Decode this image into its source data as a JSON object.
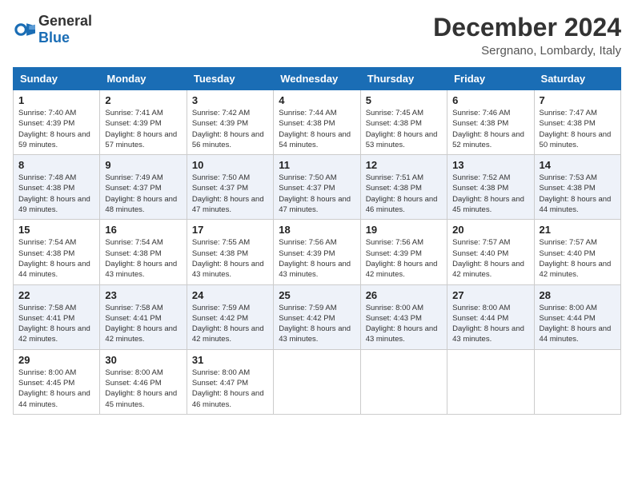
{
  "header": {
    "logo_general": "General",
    "logo_blue": "Blue",
    "month_year": "December 2024",
    "location": "Sergnano, Lombardy, Italy"
  },
  "weekdays": [
    "Sunday",
    "Monday",
    "Tuesday",
    "Wednesday",
    "Thursday",
    "Friday",
    "Saturday"
  ],
  "weeks": [
    [
      {
        "day": "1",
        "sunrise": "Sunrise: 7:40 AM",
        "sunset": "Sunset: 4:39 PM",
        "daylight": "Daylight: 8 hours and 59 minutes."
      },
      {
        "day": "2",
        "sunrise": "Sunrise: 7:41 AM",
        "sunset": "Sunset: 4:39 PM",
        "daylight": "Daylight: 8 hours and 57 minutes."
      },
      {
        "day": "3",
        "sunrise": "Sunrise: 7:42 AM",
        "sunset": "Sunset: 4:39 PM",
        "daylight": "Daylight: 8 hours and 56 minutes."
      },
      {
        "day": "4",
        "sunrise": "Sunrise: 7:44 AM",
        "sunset": "Sunset: 4:38 PM",
        "daylight": "Daylight: 8 hours and 54 minutes."
      },
      {
        "day": "5",
        "sunrise": "Sunrise: 7:45 AM",
        "sunset": "Sunset: 4:38 PM",
        "daylight": "Daylight: 8 hours and 53 minutes."
      },
      {
        "day": "6",
        "sunrise": "Sunrise: 7:46 AM",
        "sunset": "Sunset: 4:38 PM",
        "daylight": "Daylight: 8 hours and 52 minutes."
      },
      {
        "day": "7",
        "sunrise": "Sunrise: 7:47 AM",
        "sunset": "Sunset: 4:38 PM",
        "daylight": "Daylight: 8 hours and 50 minutes."
      }
    ],
    [
      {
        "day": "8",
        "sunrise": "Sunrise: 7:48 AM",
        "sunset": "Sunset: 4:38 PM",
        "daylight": "Daylight: 8 hours and 49 minutes."
      },
      {
        "day": "9",
        "sunrise": "Sunrise: 7:49 AM",
        "sunset": "Sunset: 4:37 PM",
        "daylight": "Daylight: 8 hours and 48 minutes."
      },
      {
        "day": "10",
        "sunrise": "Sunrise: 7:50 AM",
        "sunset": "Sunset: 4:37 PM",
        "daylight": "Daylight: 8 hours and 47 minutes."
      },
      {
        "day": "11",
        "sunrise": "Sunrise: 7:50 AM",
        "sunset": "Sunset: 4:37 PM",
        "daylight": "Daylight: 8 hours and 47 minutes."
      },
      {
        "day": "12",
        "sunrise": "Sunrise: 7:51 AM",
        "sunset": "Sunset: 4:38 PM",
        "daylight": "Daylight: 8 hours and 46 minutes."
      },
      {
        "day": "13",
        "sunrise": "Sunrise: 7:52 AM",
        "sunset": "Sunset: 4:38 PM",
        "daylight": "Daylight: 8 hours and 45 minutes."
      },
      {
        "day": "14",
        "sunrise": "Sunrise: 7:53 AM",
        "sunset": "Sunset: 4:38 PM",
        "daylight": "Daylight: 8 hours and 44 minutes."
      }
    ],
    [
      {
        "day": "15",
        "sunrise": "Sunrise: 7:54 AM",
        "sunset": "Sunset: 4:38 PM",
        "daylight": "Daylight: 8 hours and 44 minutes."
      },
      {
        "day": "16",
        "sunrise": "Sunrise: 7:54 AM",
        "sunset": "Sunset: 4:38 PM",
        "daylight": "Daylight: 8 hours and 43 minutes."
      },
      {
        "day": "17",
        "sunrise": "Sunrise: 7:55 AM",
        "sunset": "Sunset: 4:38 PM",
        "daylight": "Daylight: 8 hours and 43 minutes."
      },
      {
        "day": "18",
        "sunrise": "Sunrise: 7:56 AM",
        "sunset": "Sunset: 4:39 PM",
        "daylight": "Daylight: 8 hours and 43 minutes."
      },
      {
        "day": "19",
        "sunrise": "Sunrise: 7:56 AM",
        "sunset": "Sunset: 4:39 PM",
        "daylight": "Daylight: 8 hours and 42 minutes."
      },
      {
        "day": "20",
        "sunrise": "Sunrise: 7:57 AM",
        "sunset": "Sunset: 4:40 PM",
        "daylight": "Daylight: 8 hours and 42 minutes."
      },
      {
        "day": "21",
        "sunrise": "Sunrise: 7:57 AM",
        "sunset": "Sunset: 4:40 PM",
        "daylight": "Daylight: 8 hours and 42 minutes."
      }
    ],
    [
      {
        "day": "22",
        "sunrise": "Sunrise: 7:58 AM",
        "sunset": "Sunset: 4:41 PM",
        "daylight": "Daylight: 8 hours and 42 minutes."
      },
      {
        "day": "23",
        "sunrise": "Sunrise: 7:58 AM",
        "sunset": "Sunset: 4:41 PM",
        "daylight": "Daylight: 8 hours and 42 minutes."
      },
      {
        "day": "24",
        "sunrise": "Sunrise: 7:59 AM",
        "sunset": "Sunset: 4:42 PM",
        "daylight": "Daylight: 8 hours and 42 minutes."
      },
      {
        "day": "25",
        "sunrise": "Sunrise: 7:59 AM",
        "sunset": "Sunset: 4:42 PM",
        "daylight": "Daylight: 8 hours and 43 minutes."
      },
      {
        "day": "26",
        "sunrise": "Sunrise: 8:00 AM",
        "sunset": "Sunset: 4:43 PM",
        "daylight": "Daylight: 8 hours and 43 minutes."
      },
      {
        "day": "27",
        "sunrise": "Sunrise: 8:00 AM",
        "sunset": "Sunset: 4:44 PM",
        "daylight": "Daylight: 8 hours and 43 minutes."
      },
      {
        "day": "28",
        "sunrise": "Sunrise: 8:00 AM",
        "sunset": "Sunset: 4:44 PM",
        "daylight": "Daylight: 8 hours and 44 minutes."
      }
    ],
    [
      {
        "day": "29",
        "sunrise": "Sunrise: 8:00 AM",
        "sunset": "Sunset: 4:45 PM",
        "daylight": "Daylight: 8 hours and 44 minutes."
      },
      {
        "day": "30",
        "sunrise": "Sunrise: 8:00 AM",
        "sunset": "Sunset: 4:46 PM",
        "daylight": "Daylight: 8 hours and 45 minutes."
      },
      {
        "day": "31",
        "sunrise": "Sunrise: 8:00 AM",
        "sunset": "Sunset: 4:47 PM",
        "daylight": "Daylight: 8 hours and 46 minutes."
      },
      null,
      null,
      null,
      null
    ]
  ]
}
